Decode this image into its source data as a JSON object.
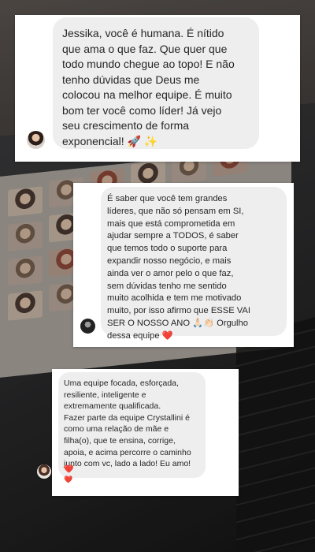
{
  "messages": [
    {
      "text": "Jessika, você é humana. É nítido\nque ama o que faz. Que quer que\ntodo mundo chegue ao topo! E não\ntenho dúvidas que Deus me\ncolocou na melhor equipe. É muito\nbom ter você como líder! Já vejo\nseu crescimento de forma\nexponencial! 🚀 ✨"
    },
    {
      "text": "É saber que você tem grandes\nlíderes, que não só pensam em SI,\nmais que está comprometida em\najudar sempre a TODOS, é saber\nque temos todo o suporte para\nexpandir nosso negócio, e mais\nainda ver o amor pelo o que faz,\nsem dúvidas tenho me sentido\nmuito acolhida e tem me motivado\nmuito, por isso afirmo que ESSE VAI\nSER O NOSSO ANO 🙏🏻👏🏻 Orgulho\ndessa equipe ❤️"
    },
    {
      "text": "Uma equipe focada, esforçada,\nresiliente, inteligente e\nextremamente qualificada.\nFazer parte da equipe Crystallini é\ncomo uma relação de mãe e\nfilha(o), que te ensina, corrige,\napoia, e acima percorre o caminho\njunto com vc, lado a lado! Eu amo!",
      "heart": "❤️",
      "reaction": "❤️"
    }
  ]
}
